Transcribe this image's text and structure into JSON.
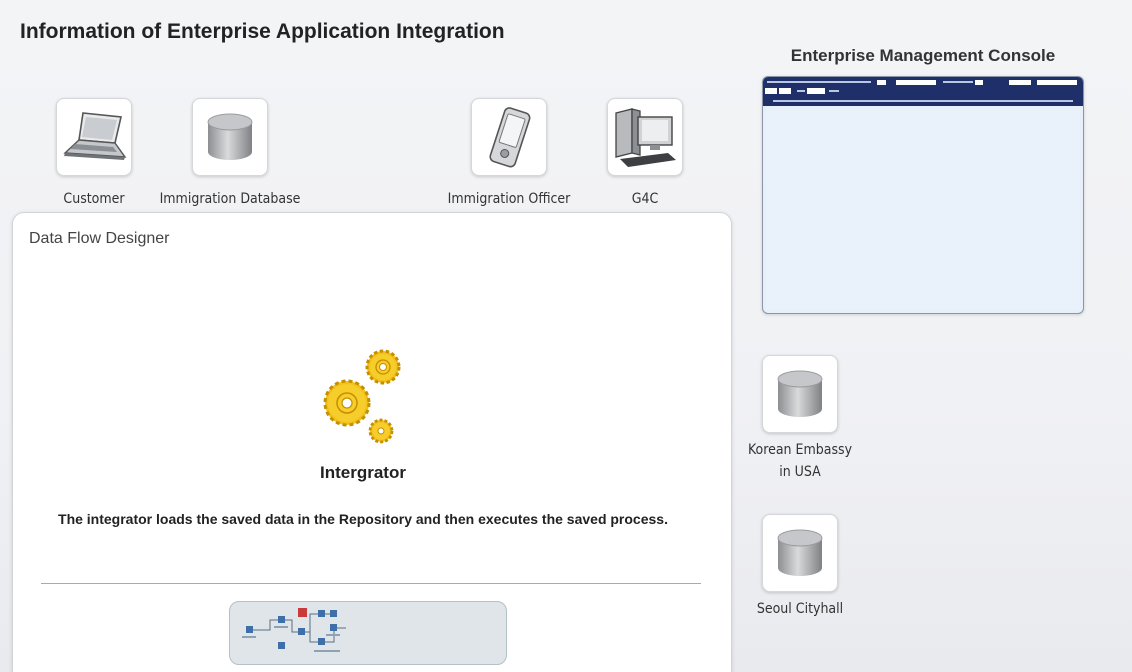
{
  "page": {
    "title": "Information of Enterprise Application Integration"
  },
  "nodes": [
    {
      "id": "customer",
      "label": "Customer",
      "icon": "laptop-icon"
    },
    {
      "id": "immigration-database",
      "label": "Immigration Database",
      "icon": "database-icon"
    },
    {
      "id": "immigration-officer",
      "label": "Immigration Officer",
      "icon": "pda-icon"
    },
    {
      "id": "g4c",
      "label": "G4C",
      "icon": "desktop-computer-icon"
    },
    {
      "id": "korean-embassy",
      "label": "Korean Embassy\nin USA",
      "icon": "database-icon"
    },
    {
      "id": "seoul-cityhall",
      "label": "Seoul Cityhall",
      "icon": "database-icon"
    }
  ],
  "designer": {
    "title": "Data Flow Designer",
    "integrator_label": "Intergrator",
    "description": "The integrator loads the saved data in the Repository and then executes the saved process."
  },
  "console": {
    "title": "Enterprise Management Console"
  },
  "colors": {
    "gear_fill": "#f2c21b",
    "gear_stroke": "#c48f00",
    "console_header": "#1e2f6a",
    "console_body": "#e9f2fb"
  }
}
